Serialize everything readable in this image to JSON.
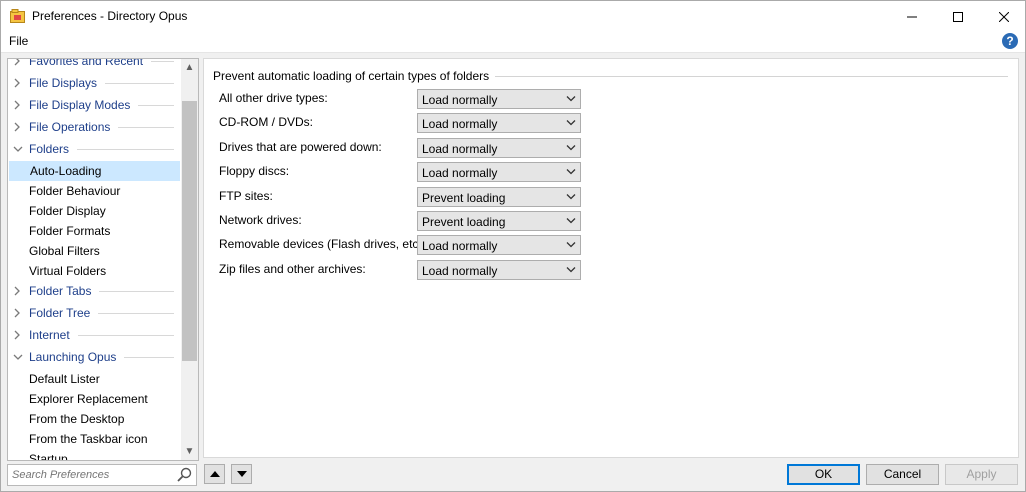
{
  "window": {
    "title": "Preferences - Directory Opus"
  },
  "menu": {
    "file": "File",
    "help": "?"
  },
  "tree": {
    "items": [
      {
        "label": "Favorites and Recent",
        "type": "category"
      },
      {
        "label": "File Displays",
        "type": "category"
      },
      {
        "label": "File Display Modes",
        "type": "category"
      },
      {
        "label": "File Operations",
        "type": "category"
      },
      {
        "label": "Folders",
        "type": "category-open"
      },
      {
        "label": "Auto-Loading",
        "type": "leaf",
        "selected": true
      },
      {
        "label": "Folder Behaviour",
        "type": "leaf"
      },
      {
        "label": "Folder Display",
        "type": "leaf"
      },
      {
        "label": "Folder Formats",
        "type": "leaf"
      },
      {
        "label": "Global Filters",
        "type": "leaf"
      },
      {
        "label": "Virtual Folders",
        "type": "leaf"
      },
      {
        "label": "Folder Tabs",
        "type": "category"
      },
      {
        "label": "Folder Tree",
        "type": "category"
      },
      {
        "label": "Internet",
        "type": "category"
      },
      {
        "label": "Launching Opus",
        "type": "category-open"
      },
      {
        "label": "Default Lister",
        "type": "leaf"
      },
      {
        "label": "Explorer Replacement",
        "type": "leaf"
      },
      {
        "label": "From the Desktop",
        "type": "leaf"
      },
      {
        "label": "From the Taskbar icon",
        "type": "leaf"
      },
      {
        "label": "Startup",
        "type": "leaf"
      }
    ]
  },
  "search": {
    "placeholder": "Search Preferences"
  },
  "panel": {
    "group_title": "Prevent automatic loading of certain types of folders",
    "rows": [
      {
        "label": "All other drive types:",
        "value": "Load normally"
      },
      {
        "label": "CD-ROM / DVDs:",
        "value": "Load normally"
      },
      {
        "label": "Drives that are powered down:",
        "value": "Load normally"
      },
      {
        "label": "Floppy discs:",
        "value": "Load normally"
      },
      {
        "label": "FTP sites:",
        "value": "Prevent loading"
      },
      {
        "label": "Network drives:",
        "value": "Prevent loading"
      },
      {
        "label": "Removable devices (Flash drives, etc):",
        "value": "Load normally"
      },
      {
        "label": "Zip files and other archives:",
        "value": "Load normally"
      }
    ]
  },
  "buttons": {
    "ok": "OK",
    "cancel": "Cancel",
    "apply": "Apply"
  },
  "colors": {
    "accent": "#0078d7",
    "selection": "#cce8ff",
    "category_text": "#1e3f8a"
  }
}
